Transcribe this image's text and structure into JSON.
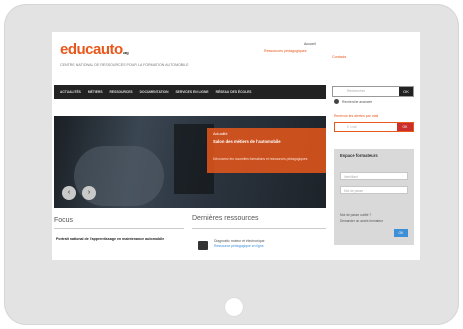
{
  "header": {
    "logo_part1": "edu",
    "logo_part2": "c",
    "logo_part3": "auto",
    "logo_suffix": ".org",
    "subtitle": "CENTRE NATIONAL DE RESSOURCES POUR LA FORMATION AUTOMOBILE",
    "links": [
      "Accueil",
      "Ressources pédagogiques",
      "Contacts"
    ]
  },
  "nav": {
    "items": [
      "Actualités",
      "Métiers",
      "Ressources",
      "Documentation",
      "Services en ligne",
      "Réseau des écoles"
    ]
  },
  "search": {
    "placeholder": "Rechercher",
    "button": "OK",
    "advanced": "Recherche avancée"
  },
  "hero": {
    "tag": "Actualité",
    "title": "Salon des métiers de l'automobile",
    "text": "Découvrez les nouvelles formations et ressources pédagogiques",
    "prev": "‹",
    "next": "›"
  },
  "alert": {
    "label": "Recevoir les alertes par mail",
    "placeholder": "E-mail",
    "button": "OK"
  },
  "member": {
    "title": "Espace formateurs",
    "login_ph": "Identifiant",
    "pass_ph": "Mot de passe",
    "link1": "Mot de passe oublié ?",
    "link2": "Demander un accès formateur",
    "button": "OK"
  },
  "focus": {
    "heading": "Focus",
    "item": "Portrait national de l'apprentissage en maintenance automobile"
  },
  "latest": {
    "heading": "Dernières ressources",
    "items": [
      "Diagnostic moteur et électronique",
      "Ressource pédagogique en ligne"
    ]
  },
  "colors": {
    "accent": "#e8571b",
    "nav": "#222222",
    "button_blue": "#3d8fd6"
  }
}
